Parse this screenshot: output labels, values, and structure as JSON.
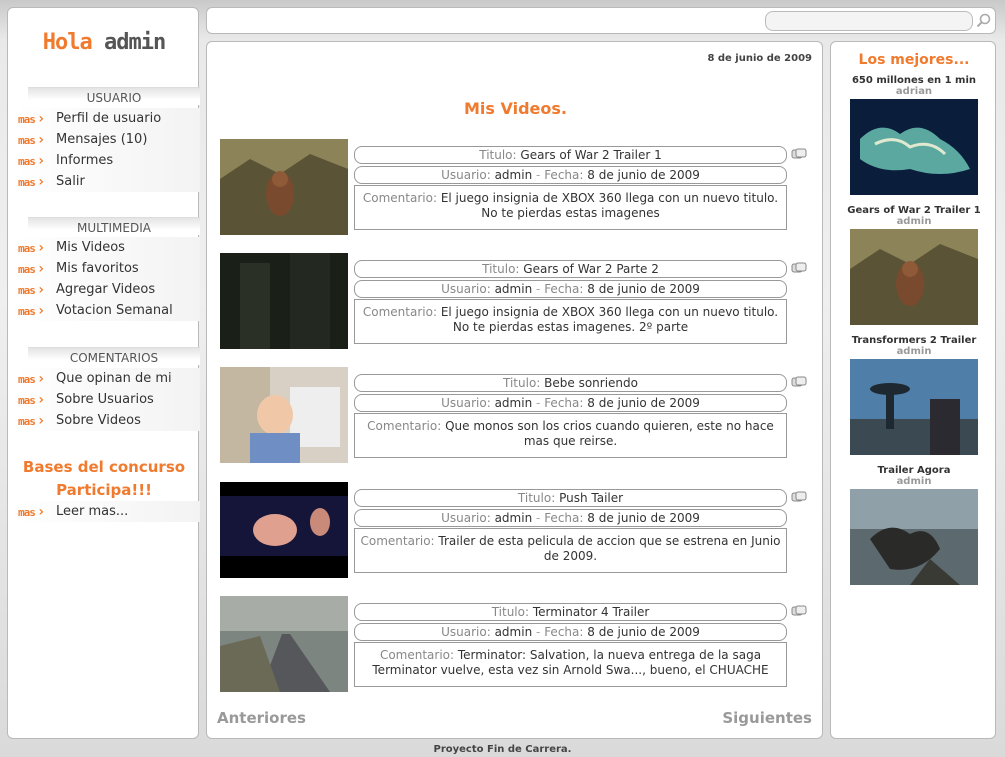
{
  "sidebar": {
    "greeting": {
      "hola": "Hola",
      "user": "admin"
    },
    "more_label": "mas",
    "sections": [
      {
        "title": "USUARIO",
        "items": [
          "Perfil de usuario",
          "Mensajes (10)",
          "Informes",
          "Salir"
        ]
      },
      {
        "title": "MULTIMEDIA",
        "items": [
          "Mis Videos",
          "Mis favoritos",
          "Agregar Videos",
          "Votacion Semanal"
        ]
      },
      {
        "title": "COMENTARIOS",
        "items": [
          "Que opinan de mi",
          "Sobre Usuarios",
          "Sobre Videos"
        ]
      }
    ],
    "contest": {
      "line1": "Bases del concurso",
      "line2": "Participa!!!",
      "link": "Leer mas..."
    }
  },
  "search": {
    "value": "",
    "placeholder": "",
    "icon": "search-icon"
  },
  "main": {
    "date": "8 de junio de 2009",
    "title": "Mis Videos.",
    "labels": {
      "title": "Titulo:",
      "user": "Usuario:",
      "date": "Fecha:",
      "comment": "Comentario:",
      "dash": "-"
    },
    "videos": [
      {
        "title": "Gears of War 2 Trailer 1",
        "user": "admin",
        "date": "8 de junio de 2009",
        "comment": "El juego insignia de XBOX 360 llega con un nuevo titulo. No te pierdas estas imagenes"
      },
      {
        "title": "Gears of War 2 Parte 2",
        "user": "admin",
        "date": "8 de junio de 2009",
        "comment": "El juego insignia de XBOX 360 llega con un nuevo titulo. No te pierdas estas imagenes. 2º parte"
      },
      {
        "title": "Bebe sonriendo",
        "user": "admin",
        "date": "8 de junio de 2009",
        "comment": "Que monos son los crios cuando quieren, este no hace mas que reirse."
      },
      {
        "title": "Push Tailer",
        "user": "admin",
        "date": "8 de junio de 2009",
        "comment": "Trailer de esta pelicula de accion que se estrena en Junio de 2009."
      },
      {
        "title": "Terminator 4 Trailer",
        "user": "admin",
        "date": "8 de junio de 2009",
        "comment": "Terminator: Salvation, la nueva entrega de la saga Terminator vuelve, esta vez sin Arnold Swa..., bueno, el CHUACHE"
      }
    ],
    "pager": {
      "prev": "Anteriores",
      "next": "Siguientes"
    }
  },
  "best": {
    "title": "Los mejores...",
    "items": [
      {
        "title": "650 millones en 1 min",
        "author": "adrian"
      },
      {
        "title": "Gears of War 2 Trailer 1",
        "author": "admin"
      },
      {
        "title": "Transformers 2 Trailer",
        "author": "admin"
      },
      {
        "title": "Trailer Agora",
        "author": "admin"
      }
    ]
  },
  "footer": "Proyecto Fin de Carrera.",
  "colors": {
    "accent": "#f07a2e",
    "label_gray": "#888888"
  }
}
